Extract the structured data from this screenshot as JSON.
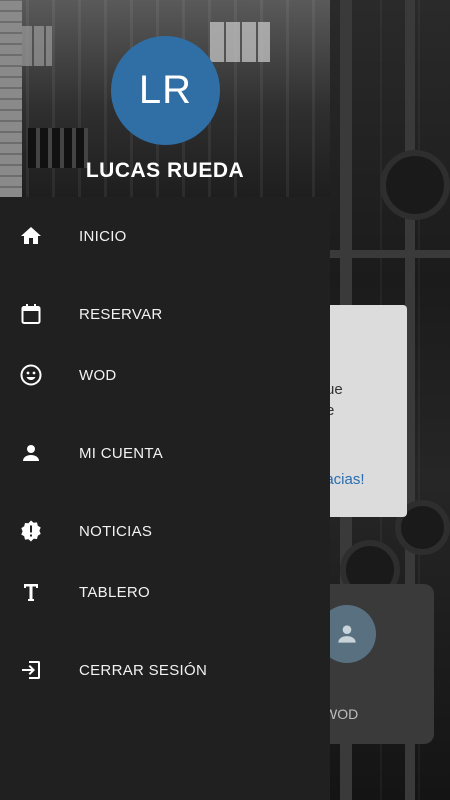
{
  "user": {
    "initials": "LR",
    "name": "LUCAS RUEDA"
  },
  "menu": [
    {
      "label": "INICIO",
      "icon": "home-icon"
    },
    {
      "label": "RESERVAR",
      "icon": "calendar-icon"
    },
    {
      "label": "WOD",
      "icon": "smiley-icon"
    },
    {
      "label": "MI CUENTA",
      "icon": "person-icon"
    },
    {
      "label": "NOTICIAS",
      "icon": "alert-badge-icon"
    },
    {
      "label": "TABLERO",
      "icon": "text-t-icon"
    },
    {
      "label": "CERRAR SESIÓN",
      "icon": "logout-icon"
    }
  ],
  "background": {
    "card_line1": "ue",
    "card_line2": "e",
    "card_link": "gracias!",
    "tile_label": "WOD"
  },
  "colors": {
    "drawer": "#202020",
    "avatar": "#2f6fa5",
    "link": "#2a6db0"
  }
}
